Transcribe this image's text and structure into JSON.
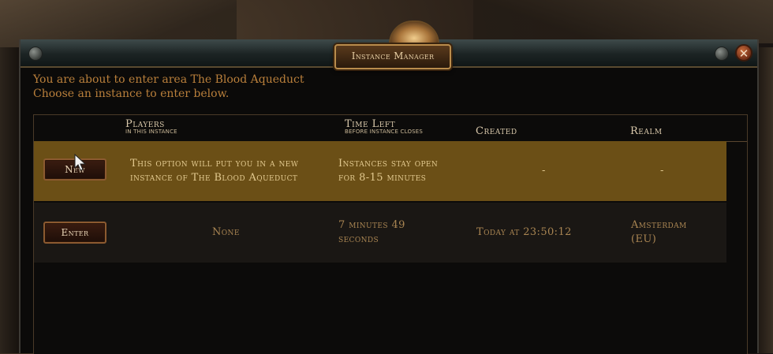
{
  "window": {
    "title": "Instance Manager",
    "close_glyph": "✕"
  },
  "intro": {
    "line1": "You are about to enter area The Blood Aqueduct",
    "line2": "Choose an instance to enter below."
  },
  "table": {
    "headers": {
      "players": "Players",
      "players_sub": "In this instance",
      "time_left": "Time Left",
      "time_left_sub": "Before instance closes",
      "created": "Created",
      "realm": "Realm"
    },
    "new_row": {
      "button": "New",
      "players_line1": "This option will put you in a new",
      "players_line2": "instance of The Blood Aqueduct",
      "time_line1": "Instances stay open",
      "time_line2": "for 8-15 minutes",
      "created": "-",
      "realm": "-"
    },
    "instance_row": {
      "button": "Enter",
      "players": "None",
      "time_line1": "7 minutes 49",
      "time_line2": "seconds",
      "created": "Today at 23:50:12",
      "realm_line1": "Amsterdam",
      "realm_line2": "(EU)"
    }
  },
  "icons": {
    "close": "close-icon",
    "cursor": "mouse-cursor-icon"
  },
  "colors": {
    "highlight_row": "#6b4f16",
    "intro_text": "#b97f3b",
    "header_text": "#d9c8ab"
  }
}
